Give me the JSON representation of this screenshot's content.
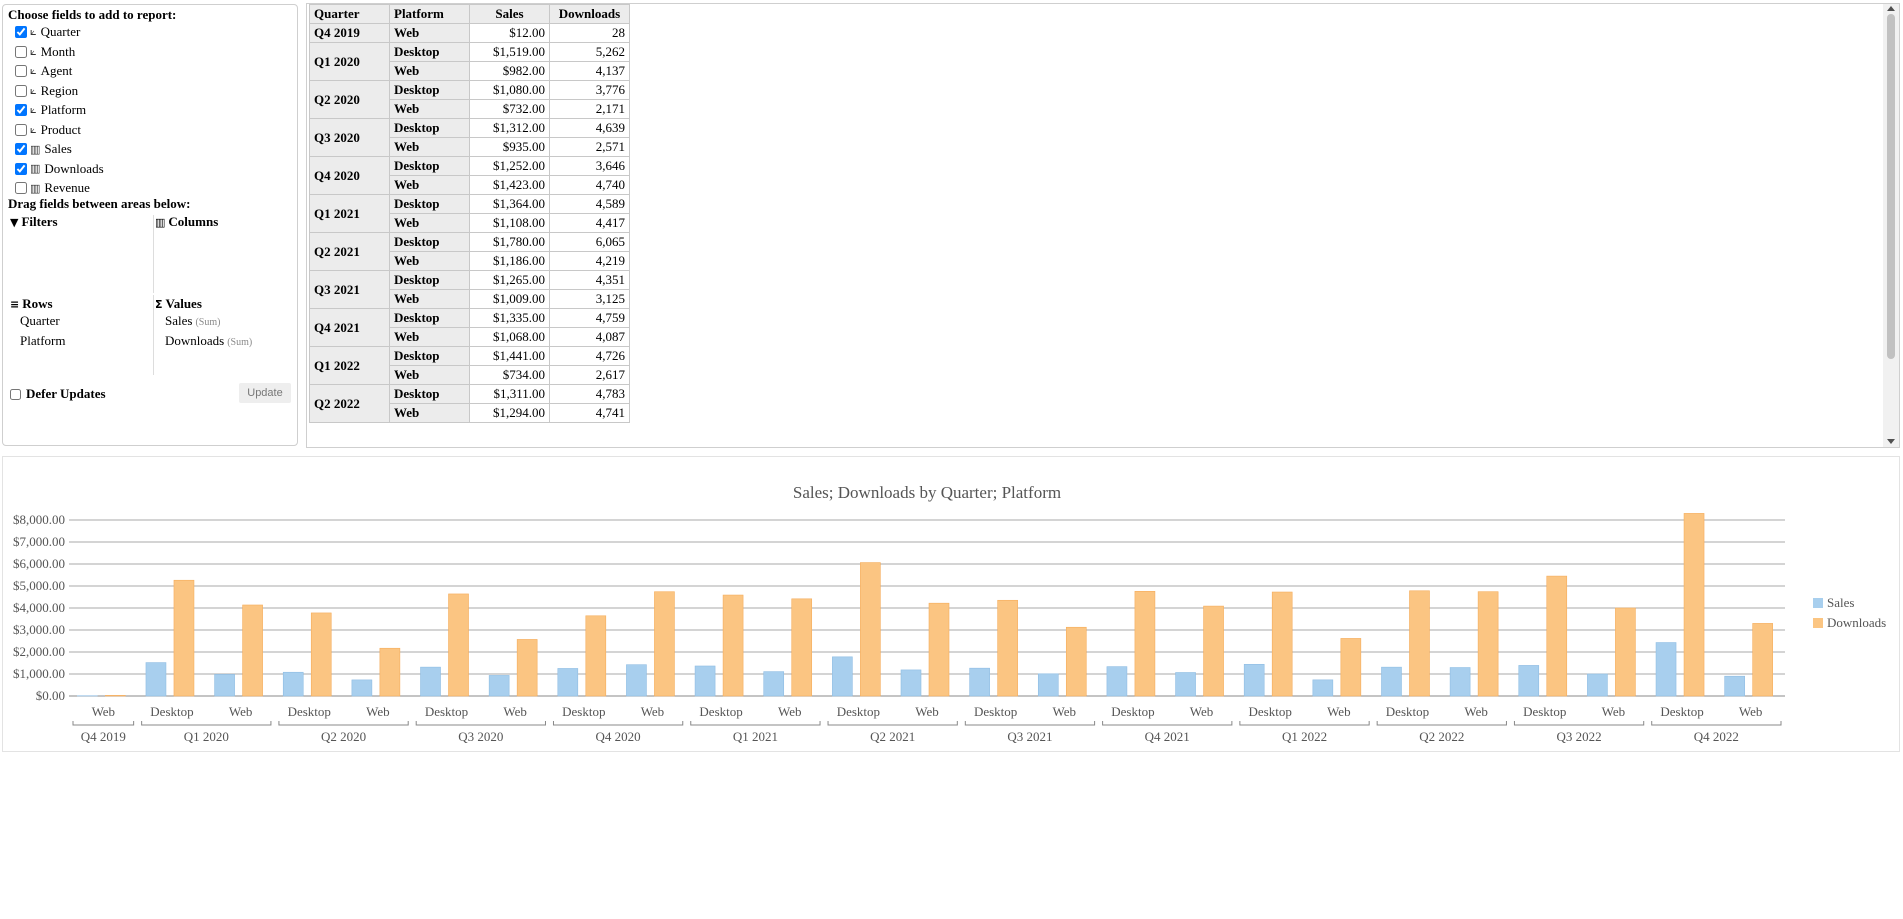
{
  "field_panel": {
    "choose_title": "Choose fields to add to report:",
    "fields": [
      {
        "label": "Quarter",
        "checked": true,
        "icon": "dimension-icon"
      },
      {
        "label": "Month",
        "checked": false,
        "icon": "dimension-icon"
      },
      {
        "label": "Agent",
        "checked": false,
        "icon": "dimension-icon"
      },
      {
        "label": "Region",
        "checked": false,
        "icon": "dimension-icon"
      },
      {
        "label": "Platform",
        "checked": true,
        "icon": "dimension-icon"
      },
      {
        "label": "Product",
        "checked": false,
        "icon": "dimension-icon"
      },
      {
        "label": "Sales",
        "checked": true,
        "icon": "measure-icon"
      },
      {
        "label": "Downloads",
        "checked": true,
        "icon": "measure-icon"
      },
      {
        "label": "Revenue",
        "checked": false,
        "icon": "measure-icon"
      }
    ],
    "drag_title": "Drag fields between areas below:",
    "areas": {
      "filters": {
        "title": "Filters",
        "icon": "filter-icon",
        "items": []
      },
      "columns": {
        "title": "Columns",
        "icon": "columns-icon",
        "items": []
      },
      "rows": {
        "title": "Rows",
        "icon": "rows-icon",
        "items": [
          "Quarter",
          "Platform"
        ]
      },
      "values": {
        "title": "Values",
        "icon": "sigma-icon",
        "items": [
          {
            "label": "Sales",
            "agg": "(Sum)"
          },
          {
            "label": "Downloads",
            "agg": "(Sum)"
          }
        ]
      }
    },
    "defer_label": "Defer Updates",
    "defer_checked": false,
    "update_label": "Update"
  },
  "grid": {
    "headers": [
      "Quarter",
      "Platform",
      "Sales",
      "Downloads"
    ],
    "groups": [
      {
        "quarter": "Q4 2019",
        "rows": [
          {
            "platform": "Web",
            "sales": "$12.00",
            "downloads": "28"
          }
        ]
      },
      {
        "quarter": "Q1 2020",
        "rows": [
          {
            "platform": "Desktop",
            "sales": "$1,519.00",
            "downloads": "5,262"
          },
          {
            "platform": "Web",
            "sales": "$982.00",
            "downloads": "4,137"
          }
        ]
      },
      {
        "quarter": "Q2 2020",
        "rows": [
          {
            "platform": "Desktop",
            "sales": "$1,080.00",
            "downloads": "3,776"
          },
          {
            "platform": "Web",
            "sales": "$732.00",
            "downloads": "2,171"
          }
        ]
      },
      {
        "quarter": "Q3 2020",
        "rows": [
          {
            "platform": "Desktop",
            "sales": "$1,312.00",
            "downloads": "4,639"
          },
          {
            "platform": "Web",
            "sales": "$935.00",
            "downloads": "2,571"
          }
        ]
      },
      {
        "quarter": "Q4 2020",
        "rows": [
          {
            "platform": "Desktop",
            "sales": "$1,252.00",
            "downloads": "3,646"
          },
          {
            "platform": "Web",
            "sales": "$1,423.00",
            "downloads": "4,740"
          }
        ]
      },
      {
        "quarter": "Q1 2021",
        "rows": [
          {
            "platform": "Desktop",
            "sales": "$1,364.00",
            "downloads": "4,589"
          },
          {
            "platform": "Web",
            "sales": "$1,108.00",
            "downloads": "4,417"
          }
        ]
      },
      {
        "quarter": "Q2 2021",
        "rows": [
          {
            "platform": "Desktop",
            "sales": "$1,780.00",
            "downloads": "6,065"
          },
          {
            "platform": "Web",
            "sales": "$1,186.00",
            "downloads": "4,219"
          }
        ]
      },
      {
        "quarter": "Q3 2021",
        "rows": [
          {
            "platform": "Desktop",
            "sales": "$1,265.00",
            "downloads": "4,351"
          },
          {
            "platform": "Web",
            "sales": "$1,009.00",
            "downloads": "3,125"
          }
        ]
      },
      {
        "quarter": "Q4 2021",
        "rows": [
          {
            "platform": "Desktop",
            "sales": "$1,335.00",
            "downloads": "4,759"
          },
          {
            "platform": "Web",
            "sales": "$1,068.00",
            "downloads": "4,087"
          }
        ]
      },
      {
        "quarter": "Q1 2022",
        "rows": [
          {
            "platform": "Desktop",
            "sales": "$1,441.00",
            "downloads": "4,726"
          },
          {
            "platform": "Web",
            "sales": "$734.00",
            "downloads": "2,617"
          }
        ]
      },
      {
        "quarter": "Q2 2022",
        "rows": [
          {
            "platform": "Desktop",
            "sales": "$1,311.00",
            "downloads": "4,783"
          },
          {
            "platform": "Web",
            "sales": "$1,294.00",
            "downloads": "4,741"
          }
        ]
      }
    ]
  },
  "chart_data": {
    "type": "bar",
    "title": "Sales; Downloads by Quarter; Platform",
    "ylim": [
      0,
      8000
    ],
    "yticks": [
      "$0.00",
      "$1,000.00",
      "$2,000.00",
      "$3,000.00",
      "$4,000.00",
      "$5,000.00",
      "$6,000.00",
      "$7,000.00",
      "$8,000.00"
    ],
    "groups": [
      {
        "label": "Q4 2019",
        "categories": [
          "Web"
        ]
      },
      {
        "label": "Q1 2020",
        "categories": [
          "Desktop",
          "Web"
        ]
      },
      {
        "label": "Q2 2020",
        "categories": [
          "Desktop",
          "Web"
        ]
      },
      {
        "label": "Q3 2020",
        "categories": [
          "Desktop",
          "Web"
        ]
      },
      {
        "label": "Q4 2020",
        "categories": [
          "Desktop",
          "Web"
        ]
      },
      {
        "label": "Q1 2021",
        "categories": [
          "Desktop",
          "Web"
        ]
      },
      {
        "label": "Q2 2021",
        "categories": [
          "Desktop",
          "Web"
        ]
      },
      {
        "label": "Q3 2021",
        "categories": [
          "Desktop",
          "Web"
        ]
      },
      {
        "label": "Q4 2021",
        "categories": [
          "Desktop",
          "Web"
        ]
      },
      {
        "label": "Q1 2022",
        "categories": [
          "Desktop",
          "Web"
        ]
      },
      {
        "label": "Q2 2022",
        "categories": [
          "Desktop",
          "Web"
        ]
      },
      {
        "label": "Q3 2022",
        "categories": [
          "Desktop",
          "Web"
        ]
      },
      {
        "label": "Q4 2022",
        "categories": [
          "Desktop",
          "Web"
        ]
      }
    ],
    "series": [
      {
        "name": "Sales",
        "color": "#a8cfee",
        "values": [
          12,
          1519,
          982,
          1080,
          732,
          1312,
          935,
          1252,
          1423,
          1364,
          1108,
          1780,
          1186,
          1265,
          1009,
          1335,
          1068,
          1441,
          734,
          1311,
          1294,
          1390,
          1000,
          2430,
          900
        ]
      },
      {
        "name": "Downloads",
        "color": "#fbc582",
        "values": [
          28,
          5262,
          4137,
          3776,
          2171,
          4639,
          2571,
          3646,
          4740,
          4589,
          4417,
          6065,
          4219,
          4351,
          3125,
          4759,
          4087,
          4726,
          2617,
          4783,
          4741,
          5450,
          4000,
          8300,
          3300
        ]
      }
    ],
    "legend_position": "right",
    "grid": true
  }
}
